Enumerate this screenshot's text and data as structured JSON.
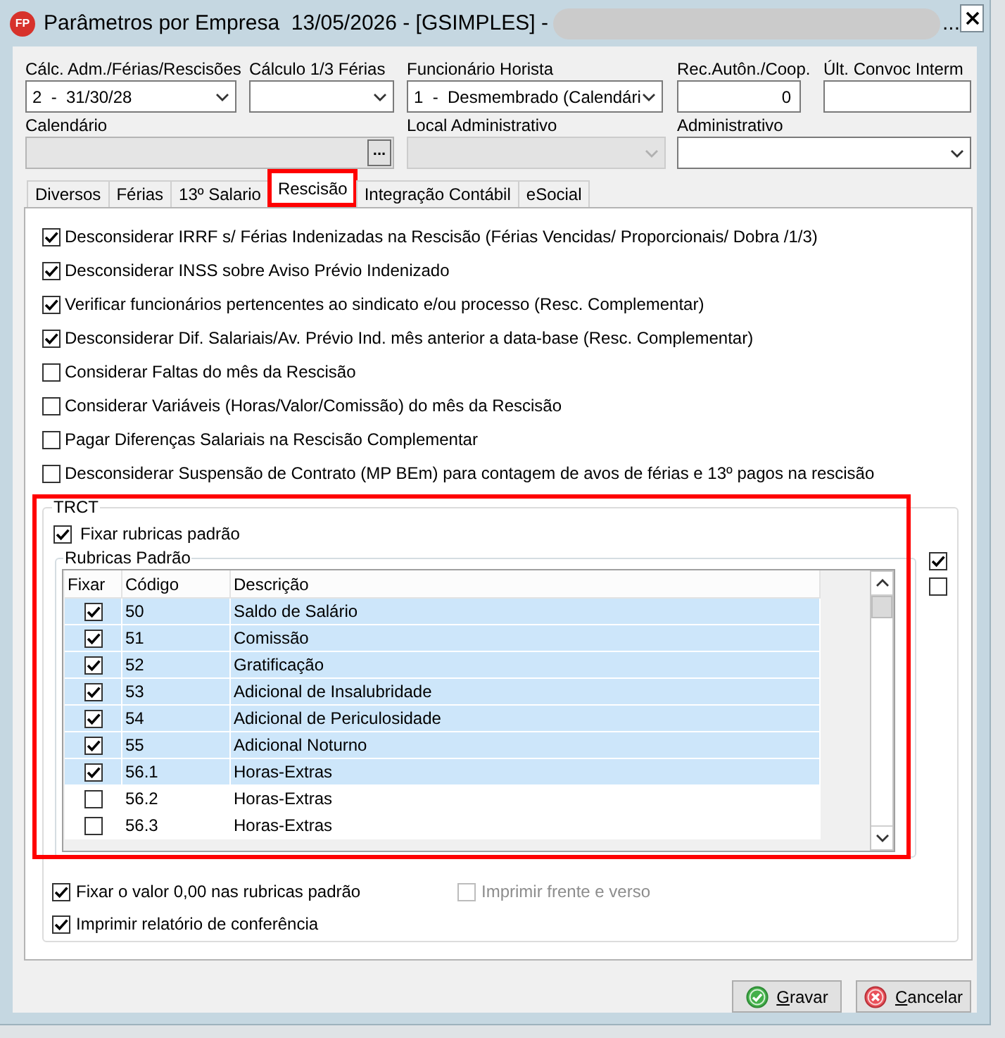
{
  "window": {
    "logo": "FP",
    "title": "Parâmetros por Empresa  13/05/2026 - [GSIMPLES] -",
    "title_redacted": true,
    "title_suffix": "..."
  },
  "field_rows": [
    [
      {
        "label": "Cálc. Adm./Férias/Rescisões",
        "kind": "combo",
        "value": "2  -  31/30/28",
        "disabled": false
      },
      {
        "label": "Cálculo 1/3 Férias",
        "kind": "combo",
        "disabled": false
      },
      {
        "label": "Funcionário Horista",
        "kind": "combo",
        "value": "1  -  Desmembrado (Calendári",
        "disabled": false
      },
      {
        "label": "Rec.Autôn./Coop.",
        "kind": "number",
        "value": "0",
        "disabled": false
      },
      {
        "label": "Últ. Convoc Interm",
        "kind": "text",
        "disabled": false
      }
    ],
    [
      {
        "label": "Calendário",
        "kind": "browse",
        "button": "...",
        "disabled": true
      },
      {
        "label": "Local Administrativo",
        "kind": "combo",
        "disabled": true
      },
      {
        "label": "Administrativo",
        "kind": "combo",
        "disabled": false
      }
    ]
  ],
  "tabs": [
    {
      "label": "Diversos",
      "selected": false,
      "highlighted": false
    },
    {
      "label": "Férias",
      "selected": false,
      "highlighted": false
    },
    {
      "label": "13º Salario",
      "selected": false,
      "highlighted": false
    },
    {
      "label": "Rescisão",
      "selected": true,
      "highlighted": true
    },
    {
      "label": "Integração Contábil",
      "selected": false,
      "highlighted": false
    },
    {
      "label": "eSocial",
      "selected": false,
      "highlighted": false
    }
  ],
  "options": [
    {
      "label": "Desconsiderar IRRF s/ Férias Indenizadas na Rescisão (Férias Vencidas/ Proporcionais/ Dobra /1/3)",
      "checked": true
    },
    {
      "label": "Desconsiderar INSS sobre Aviso Prévio Indenizado",
      "checked": true
    },
    {
      "label": "Verificar funcionários pertencentes ao sindicato e/ou processo (Resc. Complementar)",
      "checked": true
    },
    {
      "label": "Desconsiderar Dif. Salariais/Av. Prévio Ind. mês anterior a data-base (Resc. Complementar)",
      "checked": true
    },
    {
      "label": "Considerar Faltas do mês da Rescisão",
      "checked": false
    },
    {
      "label": "Considerar Variáveis (Horas/Valor/Comissão) do mês da Rescisão",
      "checked": false
    },
    {
      "label": "Pagar Diferenças Salariais na Rescisão Complementar",
      "checked": false
    },
    {
      "label": "Desconsiderar Suspensão de Contrato (MP BEm) para contagem de avos de férias e 13º pagos na rescisão",
      "checked": false
    }
  ],
  "trct": {
    "title": "TRCT",
    "highlighted": true,
    "fix_standard": {
      "label": "Fixar rubricas padrão",
      "checked": true
    },
    "group_title": "Rubricas Padrão",
    "columns": [
      "Fixar",
      "Código",
      "Descrição"
    ],
    "rows": [
      {
        "fixed": true,
        "code": "50",
        "description": "Saldo de Salário",
        "selected": true
      },
      {
        "fixed": true,
        "code": "51",
        "description": "Comissão",
        "selected": true
      },
      {
        "fixed": true,
        "code": "52",
        "description": "Gratificação",
        "selected": true
      },
      {
        "fixed": true,
        "code": "53",
        "description": "Adicional de Insalubridade",
        "selected": true
      },
      {
        "fixed": true,
        "code": "54",
        "description": "Adicional de Periculosidade",
        "selected": true
      },
      {
        "fixed": true,
        "code": "55",
        "description": "Adicional Noturno",
        "selected": true
      },
      {
        "fixed": true,
        "code": "56.1",
        "description": "Horas-Extras",
        "selected": true
      },
      {
        "fixed": false,
        "code": "56.2",
        "description": "Horas-Extras",
        "selected": false
      },
      {
        "fixed": false,
        "code": "56.3",
        "description": "Horas-Extras",
        "selected": false
      }
    ],
    "side_checks": [
      {
        "checked": true
      },
      {
        "checked": false
      }
    ],
    "bottom_options": [
      {
        "label": "Fixar o valor 0,00 nas rubricas padrão",
        "checked": true,
        "disabled": false
      },
      {
        "label": "Imprimir frente e verso",
        "checked": false,
        "disabled": true
      },
      {
        "label": "Imprimir relatório de conferência",
        "checked": true,
        "disabled": false
      }
    ]
  },
  "buttons": [
    {
      "label": "Gravar",
      "kind": "save",
      "mnemonic": true
    },
    {
      "label": "Cancelar",
      "kind": "cancel",
      "mnemonic": true
    }
  ]
}
